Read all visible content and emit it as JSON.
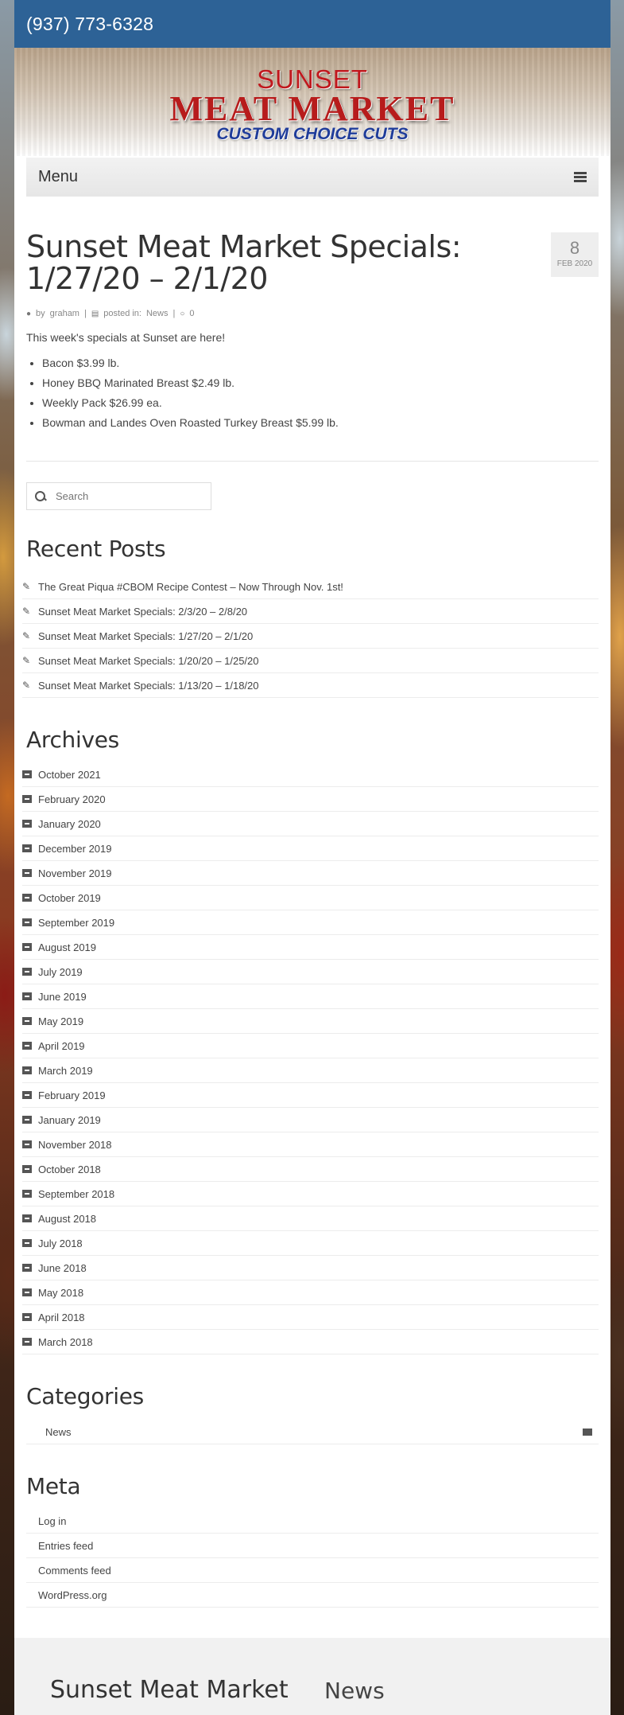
{
  "header": {
    "phone": "(937) 773-6328"
  },
  "logo": {
    "line1": "SUNSET",
    "line2": "MEAT MARKET",
    "line3": "CUSTOM CHOICE CUTS"
  },
  "nav": {
    "menu_label": "Menu",
    "menu_icon": "hamburger-icon"
  },
  "post": {
    "title": "Sunset Meat Market Specials: 1/27/20 – 2/1/20",
    "date_day": "8",
    "date_month": "FEB 2020",
    "author_prefix": "by",
    "author": "graham",
    "sep": "|",
    "posted_prefix": "posted in:",
    "category": "News",
    "comments": "0",
    "intro": "This week's specials at Sunset are here!",
    "specials": [
      "Bacon $3.99 lb.",
      "Honey BBQ Marinated Breast $2.49 lb.",
      "Weekly Pack $26.99 ea.",
      "Bowman and Landes Oven Roasted Turkey Breast $5.99 lb."
    ]
  },
  "search": {
    "placeholder": "Search"
  },
  "recent_posts": {
    "title": "Recent Posts",
    "items": [
      "The Great Piqua #CBOM Recipe Contest – Now Through Nov. 1st!",
      "Sunset Meat Market Specials: 2/3/20 – 2/8/20",
      "Sunset Meat Market Specials: 1/27/20 – 2/1/20",
      "Sunset Meat Market Specials: 1/20/20 – 1/25/20",
      "Sunset Meat Market Specials: 1/13/20 – 1/18/20"
    ]
  },
  "archives": {
    "title": "Archives",
    "items": [
      "October 2021",
      "February 2020",
      "January 2020",
      "December 2019",
      "November 2019",
      "October 2019",
      "September 2019",
      "August 2019",
      "July 2019",
      "June 2019",
      "May 2019",
      "April 2019",
      "March 2019",
      "February 2019",
      "January 2019",
      "November 2018",
      "October 2018",
      "September 2018",
      "August 2018",
      "July 2018",
      "June 2018",
      "May 2018",
      "April 2018",
      "March 2018"
    ]
  },
  "categories": {
    "title": "Categories",
    "items": [
      "News"
    ]
  },
  "meta": {
    "title": "Meta",
    "items": [
      "Log in",
      "Entries feed",
      "Comments feed",
      "WordPress.org"
    ]
  },
  "footer": {
    "site_name": "Sunset Meat Market",
    "widget_title": "News"
  },
  "colors": {
    "topbar": "#2d6296",
    "logo_red": "#c0181d",
    "logo_blue": "#1f3c9a"
  }
}
